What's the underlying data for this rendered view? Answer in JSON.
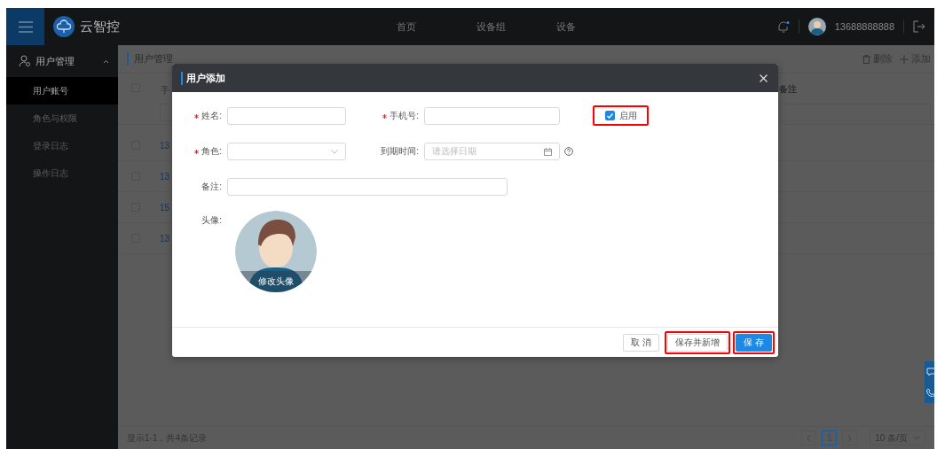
{
  "topbar": {
    "brand": "云智控",
    "nav": [
      {
        "label": "首页"
      },
      {
        "label": "设备组"
      },
      {
        "label": "设备"
      }
    ],
    "user": "13688888888"
  },
  "sidebar": {
    "group": {
      "label": "用户管理",
      "expanded": true
    },
    "items": [
      {
        "label": "用户账号",
        "selected": true
      },
      {
        "label": "角色与权限",
        "selected": false
      },
      {
        "label": "登录日志",
        "selected": false
      },
      {
        "label": "操作日志",
        "selected": false
      }
    ]
  },
  "page": {
    "title": "用户管理",
    "actions": [
      {
        "kind": "delete",
        "label": "删除"
      },
      {
        "kind": "add",
        "label": "添加"
      }
    ],
    "table": {
      "header_checked": false,
      "columns": [
        "手",
        "备注"
      ],
      "rows": [
        {
          "checked": false,
          "column_1": "13"
        },
        {
          "checked": false,
          "column_1": "13"
        },
        {
          "checked": false,
          "column_1": "15"
        },
        {
          "checked": false,
          "column_1": "13"
        }
      ]
    },
    "footer": {
      "summary": "显示1-1，共4条记录",
      "pages": [
        {
          "label": "1",
          "selected": true
        }
      ],
      "page_size": "10 条/页"
    }
  },
  "dialog": {
    "title": "用户添加",
    "fields": [
      {
        "kind": "text",
        "label": "姓名:",
        "required": true
      },
      {
        "kind": "text",
        "label": "手机号:",
        "required": true
      },
      {
        "kind": "checkbox",
        "label": "启用",
        "checked": true,
        "highlighted": true
      },
      {
        "kind": "select",
        "label": "角色:",
        "required": true
      },
      {
        "kind": "date",
        "label": "到期时间:",
        "required": false,
        "placeholder": "请选择日期"
      },
      {
        "kind": "note",
        "label": "备注:",
        "required": false
      },
      {
        "kind": "avatar",
        "label": "头像:",
        "action": "修改头像"
      }
    ],
    "buttons": [
      {
        "label": "取 消",
        "kind": "default",
        "highlighted": false
      },
      {
        "label": "保存并新增",
        "kind": "default",
        "highlighted": true
      },
      {
        "label": "保 存",
        "kind": "primary",
        "highlighted": true
      }
    ]
  }
}
